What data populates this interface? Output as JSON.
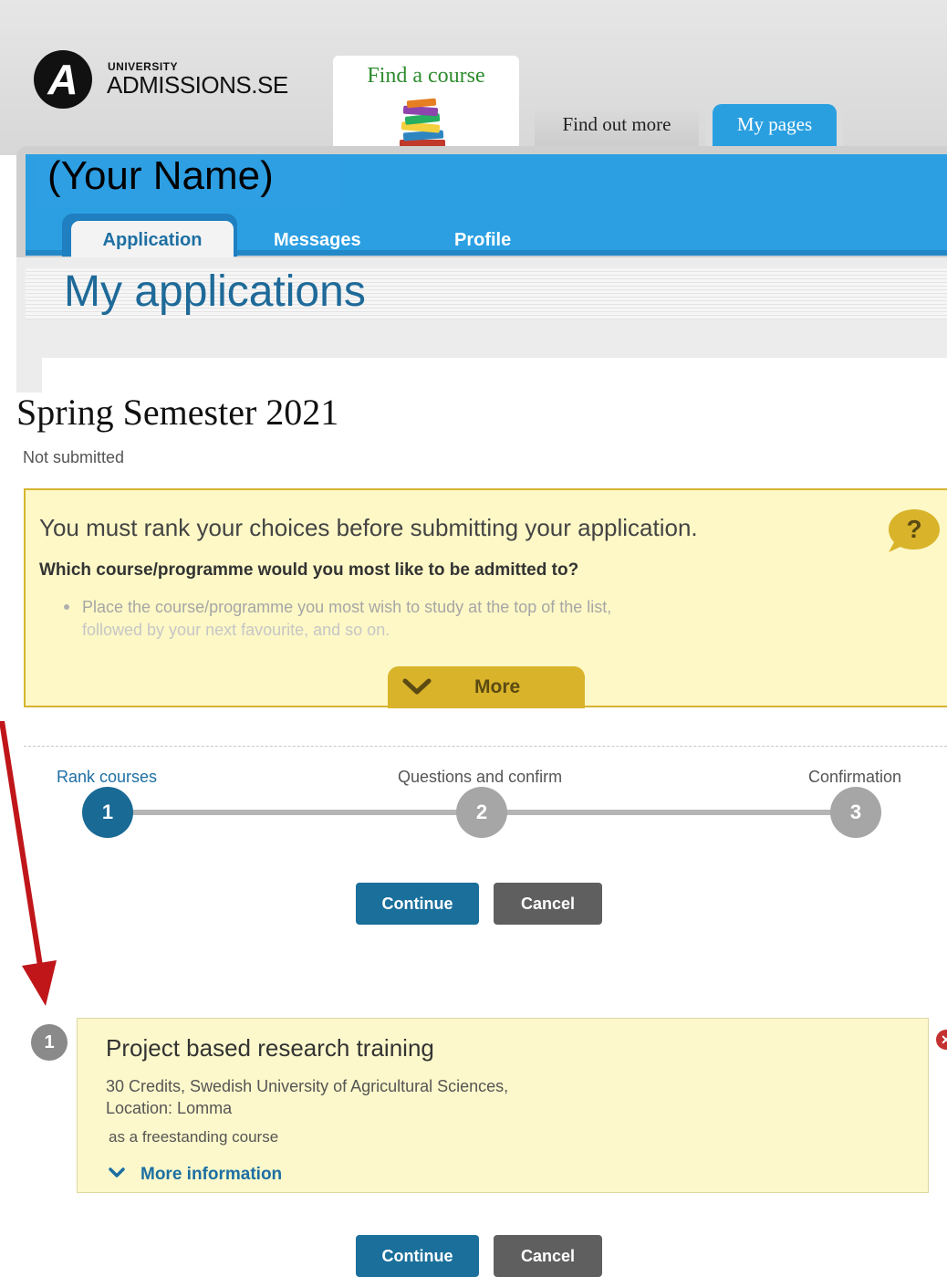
{
  "brand": {
    "logo_letter": "A",
    "logo_small": "UNIVERSITY",
    "logo_big": "ADMISSIONS.SE"
  },
  "top_tabs": {
    "find_course": "Find a course",
    "find_out_more": "Find out more",
    "my_pages": "My pages"
  },
  "user": {
    "name": "(Your Name)"
  },
  "sub_tabs": {
    "application": "Application",
    "messages": "Messages",
    "profile": "Profile"
  },
  "page": {
    "title": "My applications",
    "semester": "Spring Semester 2021",
    "status": "Not submitted"
  },
  "info_box": {
    "title": "You must rank your choices before submitting your application.",
    "question": "Which course/programme would you most like to be admitted to?",
    "bullet_line1": "Place the course/programme you most wish to study at the top of the list,",
    "bullet_line2": "followed by your next favourite, and so on.",
    "more_label": "More",
    "help_icon": "question-bubble-icon"
  },
  "stepper": {
    "steps": [
      {
        "label": "Rank courses",
        "number": "1",
        "state": "active"
      },
      {
        "label": "Questions and confirm",
        "number": "2",
        "state": "inactive"
      },
      {
        "label": "Confirmation",
        "number": "3",
        "state": "inactive"
      }
    ]
  },
  "buttons": {
    "continue": "Continue",
    "cancel": "Cancel"
  },
  "course": {
    "rank": "1",
    "title": "Project based research training",
    "detail_line1": "30 Credits, Swedish University of Agricultural Sciences,",
    "detail_line2": "Location: Lomma",
    "type": "as a freestanding course",
    "more_info": "More information",
    "remove_icon": "remove-x-icon"
  },
  "colors": {
    "brand_blue": "#2b9fe2",
    "title_blue": "#1e6a99",
    "info_yellow": "#fdf8c6",
    "more_gold": "#d9b32a",
    "continue_blue": "#1a6f9b",
    "cancel_gray": "#5f5f5f",
    "annotation_red": "#c0161a"
  }
}
